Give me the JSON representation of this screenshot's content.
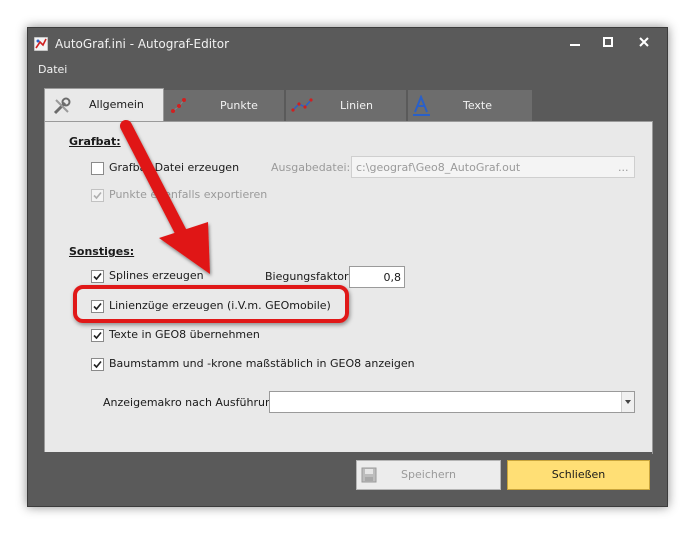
{
  "window": {
    "title": "AutoGraf.ini -   Autograf-Editor"
  },
  "menu": {
    "file": "Datei"
  },
  "tabs": [
    {
      "label": "Allgemein"
    },
    {
      "label": "Punkte"
    },
    {
      "label": "Linien"
    },
    {
      "label": "Texte"
    }
  ],
  "grafbat": {
    "heading": "Grafbat:",
    "create_file_label": "Grafbat-Datei erzeugen",
    "create_file_checked": false,
    "export_points_label": "Punkte ebenfalls exportieren",
    "export_points_checked": true,
    "output_label": "Ausgabedatei:",
    "output_value": "c:\\geograf\\Geo8_AutoGraf.out",
    "browse_label": "..."
  },
  "sonstiges": {
    "heading": "Sonstiges:",
    "splines_label": "Splines erzeugen",
    "splines_checked": true,
    "bend_label": "Biegungsfaktor:",
    "bend_value": "0,8",
    "linienzuege_label": "Linienzüge erzeugen (i.V.m. GEOmobile)",
    "linienzuege_checked": true,
    "texte_label": "Texte in GEO8 übernehmen",
    "texte_checked": true,
    "baum_label": "Baumstamm und -krone maßstäblich in GEO8 anzeigen",
    "baum_checked": true,
    "macro_label": "Anzeigemakro nach Ausführung:",
    "macro_value": ""
  },
  "buttons": {
    "save": "Speichern",
    "close": "Schließen"
  },
  "colors": {
    "accent_button": "#ffdf75",
    "annotation_red": "#e01818",
    "window_frame": "#5a5a5a"
  }
}
